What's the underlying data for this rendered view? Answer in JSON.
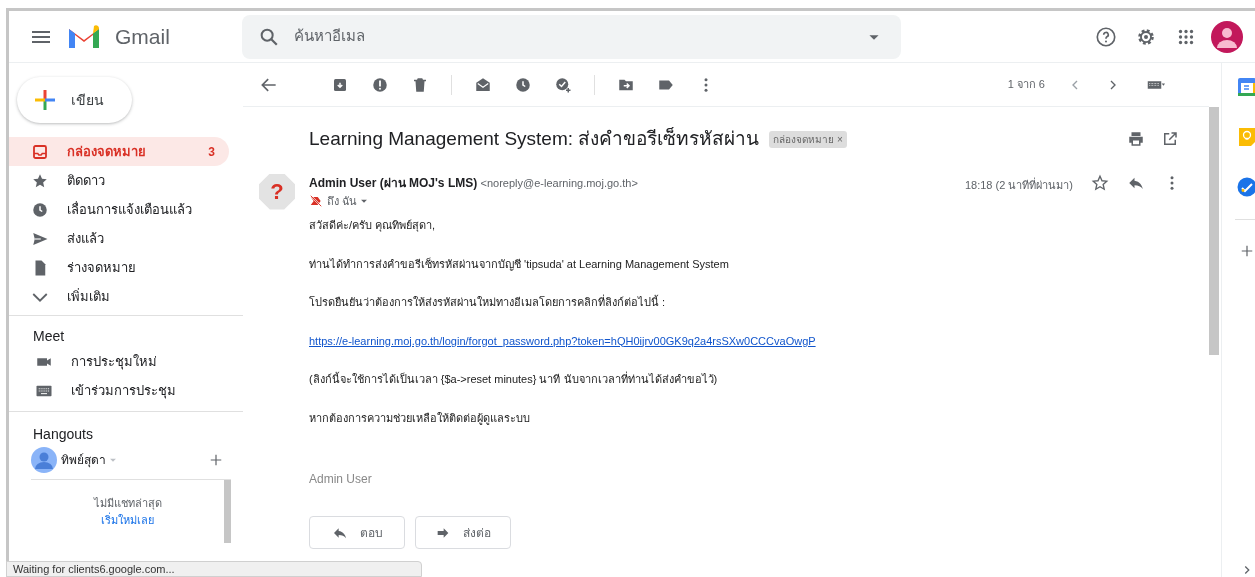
{
  "header": {
    "app_name": "Gmail",
    "search": {
      "placeholder": "ค้นหาอีเมล"
    }
  },
  "compose": {
    "label": "เขียน"
  },
  "sidebar": {
    "items": [
      {
        "label": "กล่องจดหมาย",
        "count": "3",
        "selected": true
      },
      {
        "label": "ติดดาว",
        "selected": false
      },
      {
        "label": "เลื่อนการแจ้งเตือนแล้ว",
        "selected": false
      },
      {
        "label": "ส่งแล้ว",
        "selected": false
      },
      {
        "label": "ร่างจดหมาย",
        "selected": false
      },
      {
        "label": "เพิ่มเติม",
        "selected": false
      }
    ]
  },
  "meet": {
    "title": "Meet",
    "items": [
      "การประชุมใหม่",
      "เข้าร่วมการประชุม"
    ]
  },
  "hangouts": {
    "title": "Hangouts",
    "user": "ทิพย์สุดา",
    "empty_text": "ไม่มีแชทล่าสุด",
    "start_link": "เริ่มใหม่เลย"
  },
  "toolbar": {
    "pager": "1 จาก 6"
  },
  "email": {
    "subject": "Learning Management System: ส่งคำขอรีเซ็ทรหัสผ่าน",
    "label_chip": "กล่องจดหมาย ×",
    "sender_name": "Admin User (ผ่าน MOJ's LMS)",
    "sender_email": "<noreply@e-learning.moj.go.th>",
    "recipient": "ถึง ฉัน",
    "sender_avatar": "?",
    "time": "18:18 (2 นาทีที่ผ่านมา)",
    "body": [
      {
        "kind": "text",
        "text": "สวัสดีค่ะ/ครับ คุณทิพย์สุดา,"
      },
      {
        "kind": "text",
        "text": "ท่านได้ทำการส่งคำขอรีเซ็ทรหัสผ่านจากบัญชี 'tipsuda' at Learning Management System"
      },
      {
        "kind": "text",
        "text": "โปรดยืนยันว่าต้องการให้ส่งรหัสผ่านใหม่ทางอีเมลโดยการคลิกที่ลิงก์ต่อไปนี้ :"
      },
      {
        "kind": "link",
        "text": "https://e-learning.moj.go.th/login/forgot_password.php?token=hQH0ijrv00GK9q2a4rsSXw0CCCvaOwgP"
      },
      {
        "kind": "text",
        "text": "(ลิงก์นี้จะใช้การได้เป็นเวลา {$a->reset minutes} นาที นับจากเวลาที่ท่านได้ส่งคำขอไว้)"
      },
      {
        "kind": "text",
        "text": "หากต้องการความช่วยเหลือให้ติดต่อผู้ดูแลระบบ"
      },
      {
        "kind": "signature",
        "text": "Admin User"
      }
    ],
    "buttons": [
      "ตอบ",
      "ส่งต่อ"
    ]
  },
  "status_bar": "Waiting for clients6.google.com..."
}
